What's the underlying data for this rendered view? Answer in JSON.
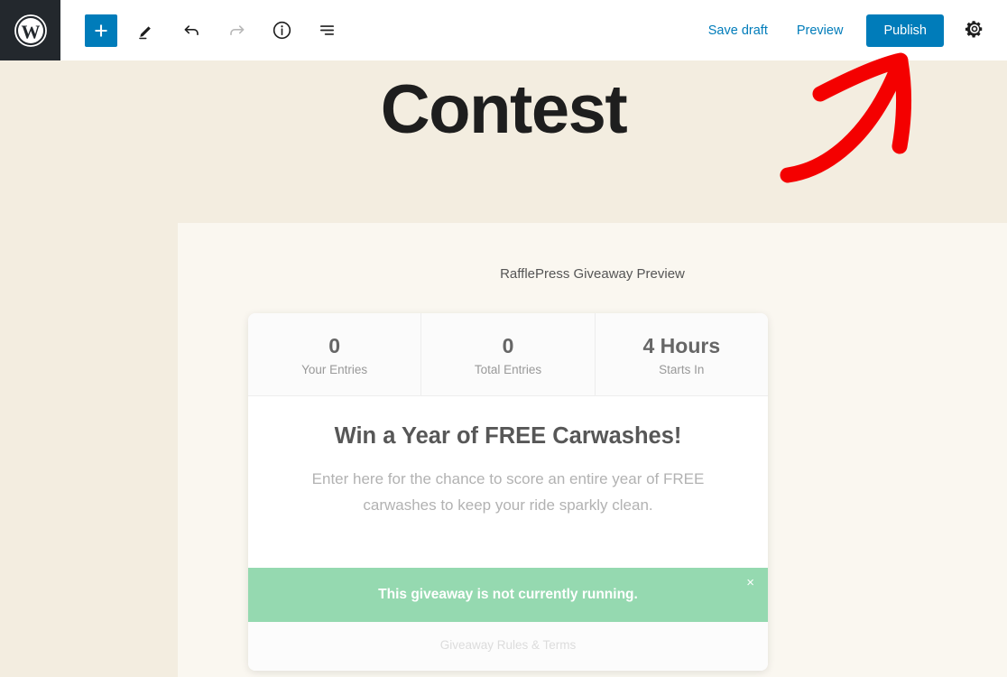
{
  "header": {
    "logo_icon": "wordpress-logo-icon",
    "add_block_icon": "plus-icon",
    "edit_icon": "pencil-icon",
    "undo_icon": "undo-arrow-icon",
    "redo_icon": "redo-arrow-icon",
    "info_icon": "info-circle-icon",
    "list_view_icon": "list-view-icon",
    "save_draft_label": "Save draft",
    "preview_label": "Preview",
    "publish_label": "Publish",
    "settings_icon": "gear-icon",
    "accent_color": "#007cba",
    "logo_bg_color": "#23282d"
  },
  "canvas": {
    "post_title": "Contest",
    "background_color": "#f3ede0",
    "block_background_color": "#faf7f0",
    "preview_label": "RafflePress Giveaway Preview"
  },
  "giveaway": {
    "stats": [
      {
        "value": "0",
        "label": "Your Entries"
      },
      {
        "value": "0",
        "label": "Total Entries"
      },
      {
        "value": "4 Hours",
        "label": "Starts In"
      }
    ],
    "headline": "Win a Year of FREE Carwashes!",
    "description": "Enter here for the chance to score an entire year of FREE carwashes to keep your ride sparkly clean.",
    "notice": {
      "text": "This giveaway is not currently running.",
      "close_label": "×",
      "background_color": "#95d9b0"
    },
    "rules_link": "Giveaway Rules & Terms"
  },
  "annotation": {
    "arrow_icon": "red-arrow-icon",
    "arrow_color": "#f40000",
    "points_to": "Publish"
  }
}
